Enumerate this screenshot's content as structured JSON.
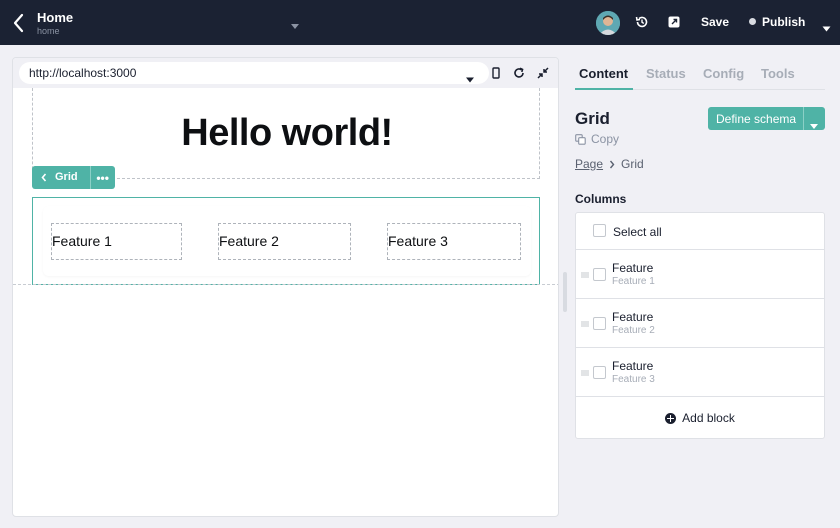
{
  "topbar": {
    "page_name": "Home",
    "page_slug": "home",
    "save_label": "Save",
    "publish_label": "Publish",
    "icons": [
      "chevron-left-icon",
      "caret-down-icon",
      "avatar",
      "history-icon",
      "external-link-icon",
      "status-dot-icon",
      "caret-down-icon"
    ]
  },
  "canvas": {
    "url": "http://localhost:3000",
    "hero_title": "Hello world!",
    "selected_block_label": "Grid",
    "more_label": "•••",
    "features": [
      "Feature 1",
      "Feature 2",
      "Feature 3"
    ],
    "icons": [
      "caret-down-icon",
      "mobile-device-icon",
      "reload-icon",
      "collapse-icon",
      "chevron-left-icon"
    ]
  },
  "sidebar": {
    "tabs": [
      "Content",
      "Status",
      "Config",
      "Tools"
    ],
    "active_tab": "Content",
    "block_title": "Grid",
    "copy_label": "Copy",
    "define_schema_label": "Define schema",
    "breadcrumb": [
      "Page",
      "Grid"
    ],
    "columns_label": "Columns",
    "select_all_label": "Select all",
    "columns": [
      {
        "title": "Feature",
        "subtitle": "Feature 1"
      },
      {
        "title": "Feature",
        "subtitle": "Feature 2"
      },
      {
        "title": "Feature",
        "subtitle": "Feature 3"
      }
    ],
    "add_block_label": "Add block"
  },
  "colors": {
    "topbar_bg": "#1b2233",
    "accent": "#4fb3a6",
    "background": "#f0f0f5"
  }
}
